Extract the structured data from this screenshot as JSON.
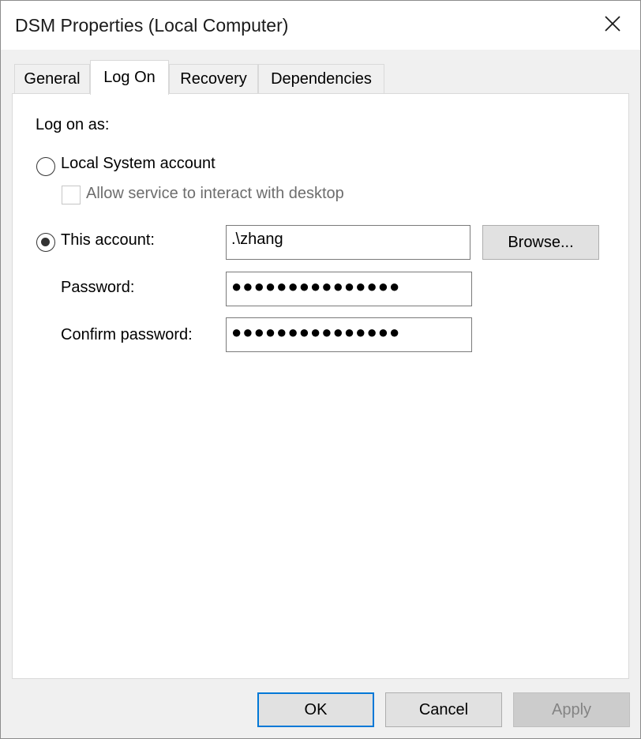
{
  "window": {
    "title": "DSM Properties (Local Computer)"
  },
  "tabs": [
    {
      "label": "General",
      "active": false
    },
    {
      "label": "Log On",
      "active": true
    },
    {
      "label": "Recovery",
      "active": false
    },
    {
      "label": "Dependencies",
      "active": false
    }
  ],
  "logon": {
    "heading": "Log on as:",
    "local_system_label": "Local System account",
    "local_system_selected": false,
    "interact_desktop_label": "Allow service to interact with desktop",
    "interact_desktop_checked": false,
    "interact_desktop_enabled": false,
    "this_account_label": "This account:",
    "this_account_selected": true,
    "account_value": ".\\zhang",
    "browse_label": "Browse...",
    "password_label": "Password:",
    "password_value": "●●●●●●●●●●●●●●●",
    "confirm_label": "Confirm password:",
    "confirm_value": "●●●●●●●●●●●●●●●"
  },
  "footer": {
    "ok_label": "OK",
    "cancel_label": "Cancel",
    "apply_label": "Apply",
    "apply_enabled": false
  },
  "colors": {
    "accent": "#0078d7",
    "dialog_bg": "#f0f0f0",
    "panel_bg": "#ffffff"
  }
}
